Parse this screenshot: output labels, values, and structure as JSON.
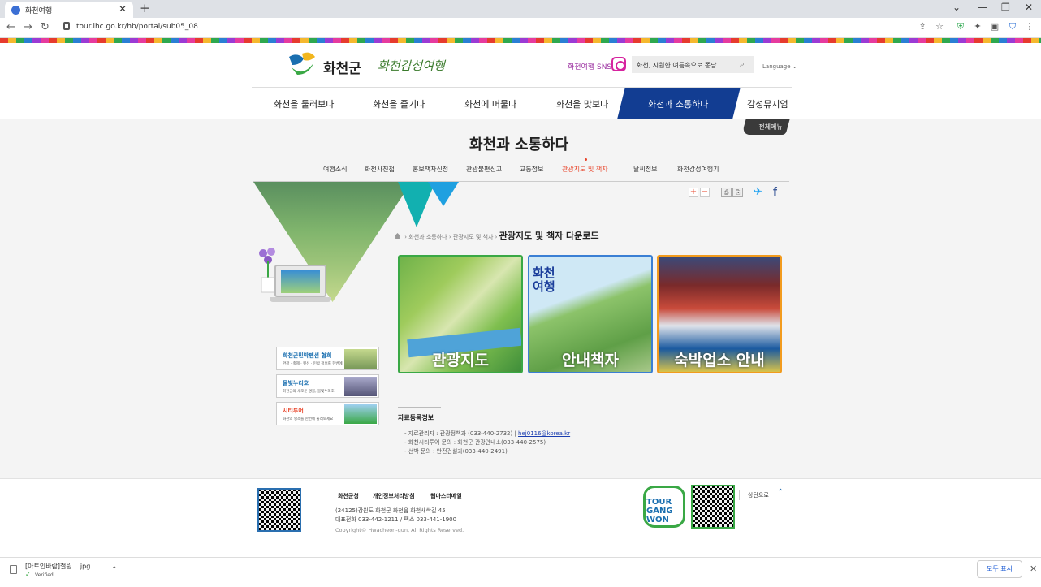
{
  "browser": {
    "tab_title": "화천여행",
    "tab_close": "✕",
    "new_tab": "+",
    "url": "tour.ihc.go.kr/hb/portal/sub05_08",
    "minimize": "⌄",
    "minimize2": "—",
    "restore": "❐",
    "close": "✕",
    "back": "←",
    "forward": "→",
    "reload": "↻"
  },
  "header": {
    "logo_name": "화천군",
    "slogan": "화천감성여행",
    "sns_label": "화천여행 SNS",
    "search_placeholder": "화천, 시원한 여름속으로 퐁당",
    "language": "Language ⌄"
  },
  "nav": {
    "items": [
      "화천을 둘러보다",
      "화천을 즐기다",
      "화천에 머물다",
      "화천을 맛보다",
      "화천과 소통하다",
      "감성뮤지엄"
    ],
    "all_menu": "+ 전체메뉴"
  },
  "page": {
    "title": "화천과 소통하다",
    "subnav": [
      "여행소식",
      "화천사진첩",
      "홍보책자신청",
      "관광불편신고",
      "교통정보",
      "관광지도 및 책자",
      "날씨정보",
      "화천감성여행기"
    ],
    "breadcrumb": [
      "화천과 소통하다",
      "관광지도 및 책자"
    ],
    "breadcrumb_current": "관광지도 및 책자 다운로드",
    "tools": {
      "zoom_in": "+",
      "zoom_out": "−",
      "print": "⎙",
      "save": "⎘",
      "twitter": "🐦",
      "facebook": "f"
    }
  },
  "cards": [
    {
      "label": "관광지도"
    },
    {
      "label": "안내책자",
      "title": "화천 여행"
    },
    {
      "label": "숙박업소 안내"
    }
  ],
  "side_banners": [
    {
      "title": "화천군민박펜션 협회",
      "sub": "관광 · 축제 · 펜션 · 민박 정보를 한번에",
      "color": "#1a6fb0"
    },
    {
      "title": "물빛누리호",
      "sub": "화천군의 새로운 명물, 물빛누리호",
      "color": "#1a6fb0"
    },
    {
      "title": "시티투어",
      "sub": "화천의 명소를 한번에 둘러보세요",
      "color": "#e8452b"
    }
  ],
  "info": {
    "title": "자료등록정보",
    "rows": [
      {
        "text": "- 자료관리자 : 관광정책과 (033-440-2732)  |  ",
        "link": "hej0116@korea.kr"
      },
      {
        "text": "- 화천시티투어  문의 : 화천군 관광안내소(033-440-2575)",
        "link": ""
      },
      {
        "text": "- 선박 문의 : 안전건설과(033-440-2491)",
        "link": ""
      }
    ]
  },
  "footer": {
    "links": [
      "화천군청",
      "개인정보처리방침",
      "웹마스터메일"
    ],
    "address": "(24125)강원도 화천군 화천읍 화천새싹길 45",
    "phone": "대표전화 033-442-1211 / 팩스 033-441-1900",
    "copyright": "Copyright© Hwacheon-gun, All Rights Reserved.",
    "tour_logo": "TOUR GANG WON",
    "top_link": "상단으로"
  },
  "download": {
    "filename": "[아트인바람]철원....jpg",
    "status": "Verified",
    "show_all": "모두 표시",
    "close": "✕"
  },
  "colors": {
    "nav_active": "#123d92",
    "accent_red": "#e8452b",
    "green": "#3aa845"
  }
}
